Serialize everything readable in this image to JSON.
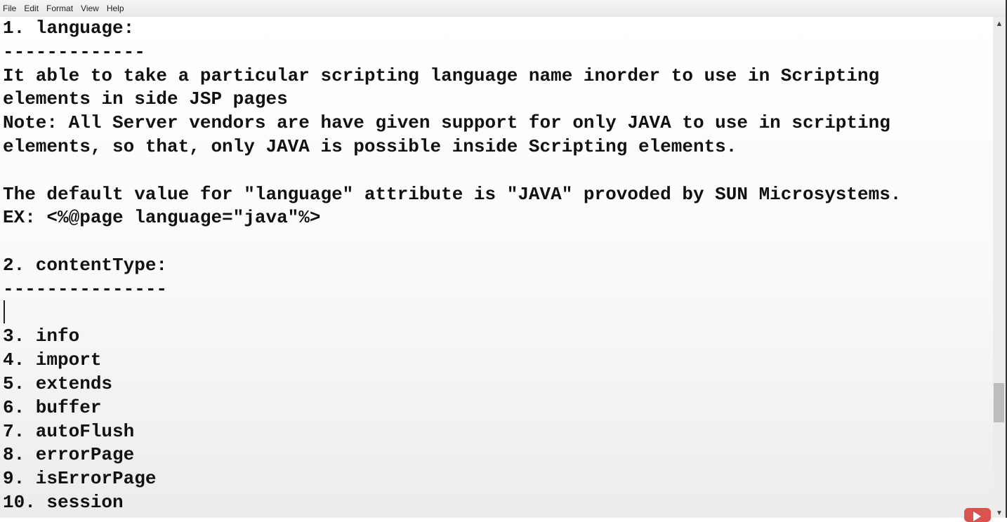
{
  "menu": [
    "File",
    "Edit",
    "Format",
    "View",
    "Help"
  ],
  "lines": [
    "1. language:",
    "-------------",
    "It able to take a particular scripting language name inorder to use in Scripting",
    "elements in side JSP pages",
    "Note: All Server vendors are have given support for only JAVA to use in scripting",
    "elements, so that, only JAVA is possible inside Scripting elements.",
    "",
    "The default value for \"language\" attribute is \"JAVA\" provoded by SUN Microsystems.",
    "EX: <%@page language=\"java\"%>",
    "",
    "2. contentType:",
    "---------------",
    "",
    "3. info",
    "4. import",
    "5. extends",
    "6. buffer",
    "7. autoFlush",
    "8. errorPage",
    "9. isErrorPage",
    "10. session"
  ],
  "scroll_position_fraction": 0.75
}
